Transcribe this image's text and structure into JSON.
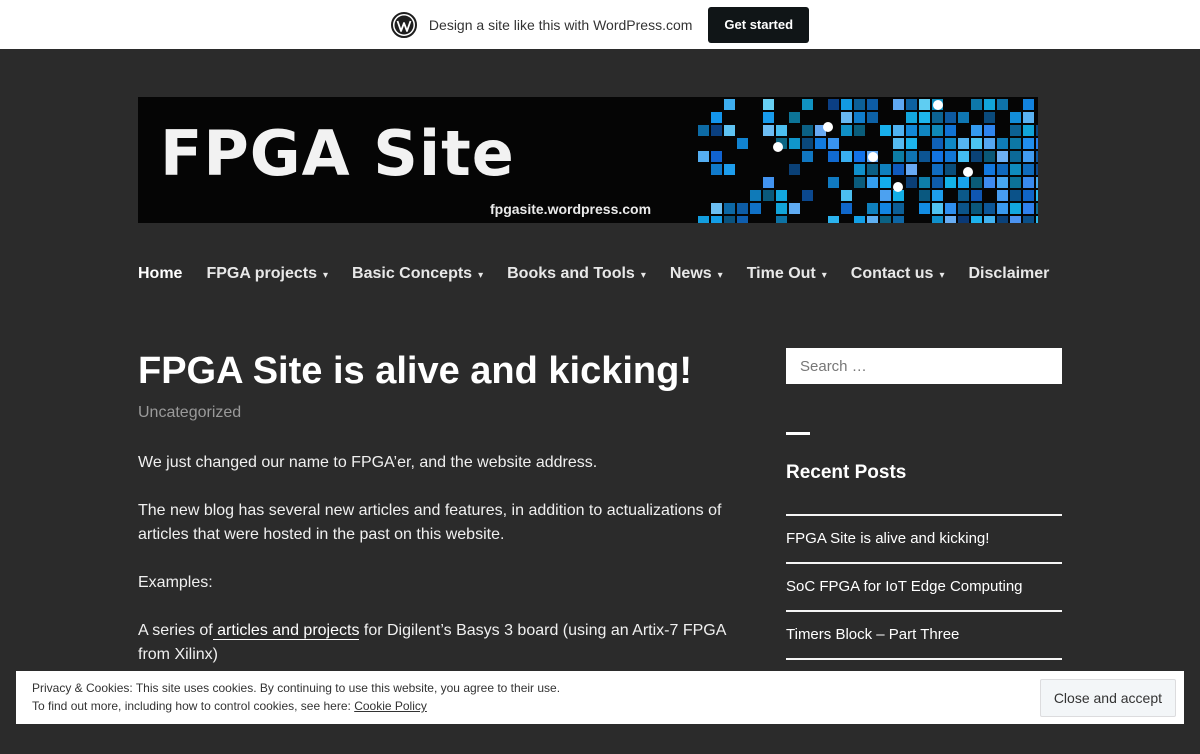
{
  "wpbar": {
    "logo_icon": "wordpress-logo-icon",
    "text": "Design a site like this with WordPress.com",
    "button": "Get started"
  },
  "banner": {
    "title": "FPGA Site",
    "url": "fpgasite.wordpress.com"
  },
  "nav": {
    "items": [
      {
        "label": "Home",
        "dropdown": false
      },
      {
        "label": "FPGA projects",
        "dropdown": true
      },
      {
        "label": "Basic Concepts",
        "dropdown": true
      },
      {
        "label": "Books and Tools",
        "dropdown": true
      },
      {
        "label": "News",
        "dropdown": true
      },
      {
        "label": "Time Out",
        "dropdown": true
      },
      {
        "label": "Contact us",
        "dropdown": true
      },
      {
        "label": "Disclaimer",
        "dropdown": false
      }
    ],
    "chevron": "▾"
  },
  "post": {
    "title": "FPGA Site is alive and kicking!",
    "category": "Uncategorized",
    "p1": "We just changed our name to FPGA’er, and the website address.",
    "p2": "The new blog has several new articles and features, in addition to actualizations of articles that were hosted in the past on this website.",
    "p3": "Examples:",
    "p4_before": "A series of",
    "p4_link": " articles and projects",
    "p4_after": " for Digilent’s Basys 3 board (using an Artix-7 FPGA from Xilinx)"
  },
  "sidebar": {
    "search_placeholder": "Search …",
    "widget_title": "Recent Posts",
    "recent": [
      "FPGA Site is alive and kicking!",
      "SoC FPGA for IoT Edge Computing",
      "Timers Block – Part Three",
      "",
      ""
    ]
  },
  "cookie": {
    "line1": "Privacy & Cookies: This site uses cookies. By continuing to use this website, you agree to their use.",
    "line2_before": "To find out more, including how to control cookies, see here: ",
    "line2_link": "Cookie Policy",
    "button": "Close and accept"
  },
  "colors": {
    "background": "#2b2b2b",
    "text": "#ffffff",
    "muted": "#9a9a9a",
    "banner_blue": "#1ea0e6"
  }
}
